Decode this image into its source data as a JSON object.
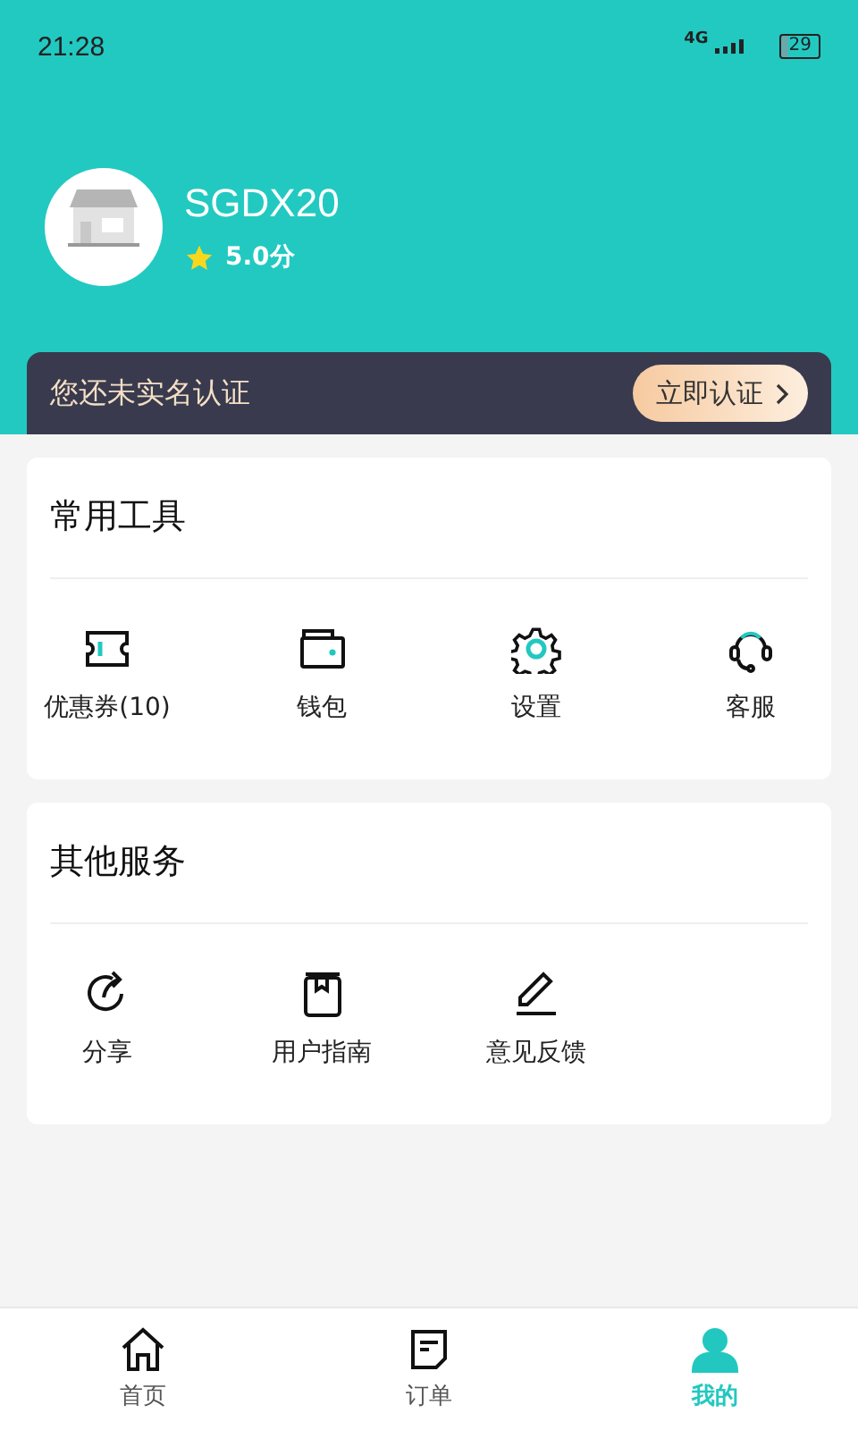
{
  "status_bar": {
    "time": "21:28",
    "network": "4G",
    "battery": "29"
  },
  "profile": {
    "name": "SGDX20",
    "rating": "5.0分"
  },
  "verify_banner": {
    "text": "您还未实名认证",
    "button": "立即认证"
  },
  "sections": [
    {
      "title": "常用工具",
      "items": [
        {
          "label": "优惠券(10)",
          "kind": "ticket"
        },
        {
          "label": "钱包",
          "kind": "wallet"
        },
        {
          "label": "设置",
          "kind": "gear"
        },
        {
          "label": "客服",
          "kind": "headset"
        }
      ]
    },
    {
      "title": "其他服务",
      "items": [
        {
          "label": "分享",
          "kind": "share"
        },
        {
          "label": "用户指南",
          "kind": "book"
        },
        {
          "label": "意见反馈",
          "kind": "pencil"
        }
      ]
    }
  ],
  "bottom_nav": [
    {
      "label": "首页",
      "kind": "home",
      "selected": false
    },
    {
      "label": "订单",
      "kind": "order",
      "selected": false
    },
    {
      "label": "我的",
      "kind": "person",
      "selected": true
    }
  ]
}
